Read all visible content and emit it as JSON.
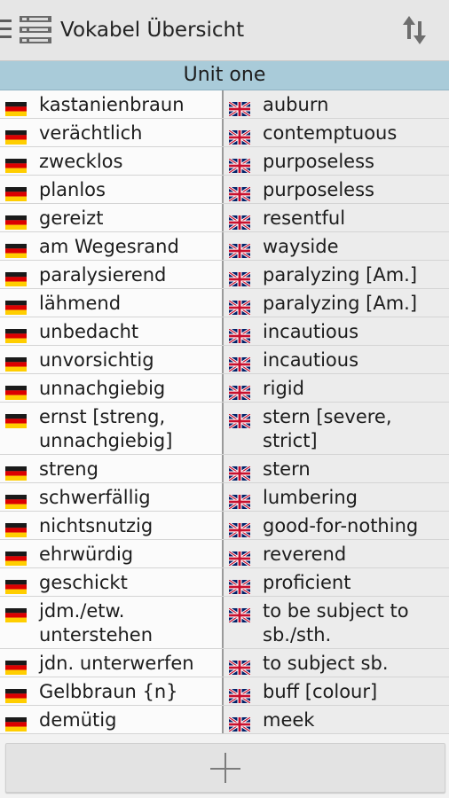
{
  "app": {
    "title": "Vokabel Übersicht",
    "icons": {
      "drawer": "drawer-menu-icon",
      "app": "list-icon",
      "sort": "sort-arrows-icon",
      "add": "plus-icon"
    }
  },
  "section": {
    "title": "Unit one"
  },
  "flags": {
    "de": "german-flag-icon",
    "en": "uk-flag-icon"
  },
  "entries": [
    {
      "de": "kastanienbraun",
      "en": "auburn"
    },
    {
      "de": "verächtlich",
      "en": "contemptuous"
    },
    {
      "de": "zwecklos",
      "en": "purposeless"
    },
    {
      "de": "planlos",
      "en": "purposeless"
    },
    {
      "de": "gereizt",
      "en": "resentful"
    },
    {
      "de": "am Wegesrand",
      "en": "wayside"
    },
    {
      "de": "paralysierend",
      "en": "paralyzing [Am.]"
    },
    {
      "de": "lähmend",
      "en": "paralyzing [Am.]"
    },
    {
      "de": "unbedacht",
      "en": "incautious"
    },
    {
      "de": "unvorsichtig",
      "en": "incautious"
    },
    {
      "de": "unnachgiebig",
      "en": "rigid"
    },
    {
      "de": "ernst [streng, unnachgiebig]",
      "en": "stern [severe, strict]"
    },
    {
      "de": "streng",
      "en": "stern"
    },
    {
      "de": "schwerfällig",
      "en": "lumbering"
    },
    {
      "de": "nichtsnutzig",
      "en": "good-for-nothing"
    },
    {
      "de": "ehrwürdig",
      "en": "reverend"
    },
    {
      "de": "geschickt",
      "en": "proficient"
    },
    {
      "de": "jdm./etw. unterstehen",
      "en": "to be subject to sb./sth."
    },
    {
      "de": "jdn. unterwerfen",
      "en": "to subject sb."
    },
    {
      "de": "Gelbbraun {n}",
      "en": "buff [colour]"
    },
    {
      "de": "demütig",
      "en": "meek"
    }
  ]
}
